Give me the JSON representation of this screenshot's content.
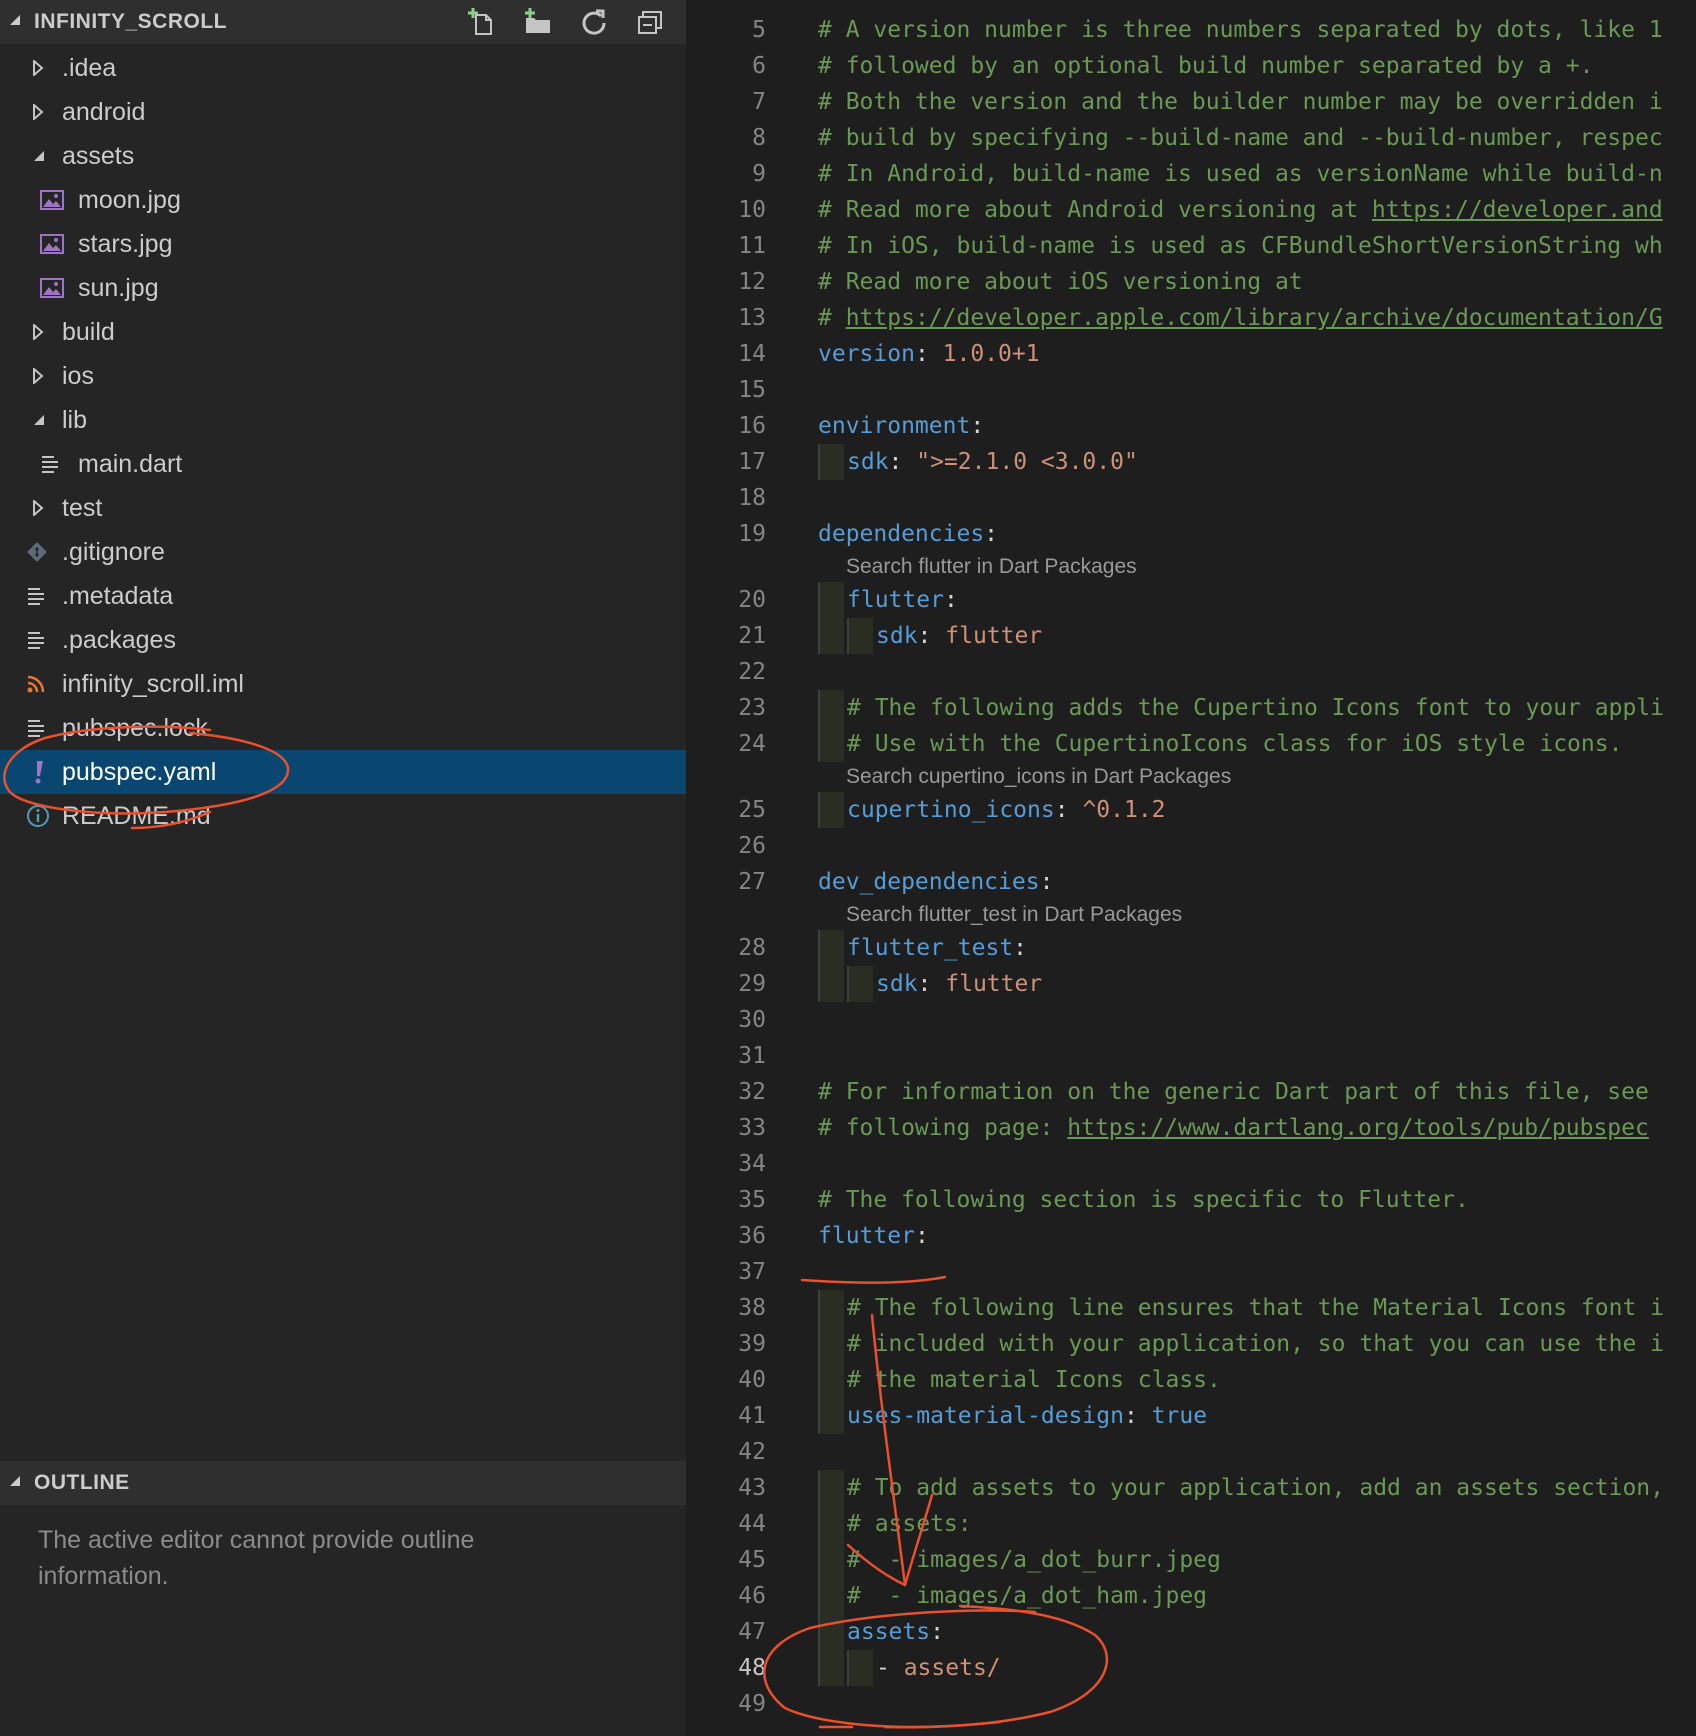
{
  "explorer": {
    "title": "INFINITY_SCROLL",
    "actions": [
      "new-file",
      "new-folder",
      "refresh",
      "collapse-all"
    ],
    "items": [
      {
        "label": ".idea",
        "type": "folder",
        "expanded": false,
        "depth": 0
      },
      {
        "label": "android",
        "type": "folder",
        "expanded": false,
        "depth": 0
      },
      {
        "label": "assets",
        "type": "folder",
        "expanded": true,
        "depth": 0
      },
      {
        "label": "moon.jpg",
        "type": "image",
        "depth": 1
      },
      {
        "label": "stars.jpg",
        "type": "image",
        "depth": 1
      },
      {
        "label": "sun.jpg",
        "type": "image",
        "depth": 1
      },
      {
        "label": "build",
        "type": "folder",
        "expanded": false,
        "depth": 0
      },
      {
        "label": "ios",
        "type": "folder",
        "expanded": false,
        "depth": 0
      },
      {
        "label": "lib",
        "type": "folder",
        "expanded": true,
        "depth": 0
      },
      {
        "label": "main.dart",
        "type": "lines",
        "depth": 1
      },
      {
        "label": "test",
        "type": "folder",
        "expanded": false,
        "depth": 0
      },
      {
        "label": ".gitignore",
        "type": "git",
        "depth": 0
      },
      {
        "label": ".metadata",
        "type": "lines",
        "depth": 0
      },
      {
        "label": ".packages",
        "type": "lines",
        "depth": 0
      },
      {
        "label": "infinity_scroll.iml",
        "type": "rss",
        "depth": 0
      },
      {
        "label": "pubspec.lock",
        "type": "lines",
        "depth": 0
      },
      {
        "label": "pubspec.yaml",
        "type": "yaml",
        "depth": 0,
        "selected": true
      },
      {
        "label": "README.md",
        "type": "info",
        "depth": 0
      }
    ]
  },
  "outline": {
    "title": "OUTLINE",
    "message": "The active editor cannot provide outline information."
  },
  "editor": {
    "current_line": 48,
    "lines": [
      {
        "n": 5,
        "code": "# A version number is three numbers separated by dots, like 1"
      },
      {
        "n": 6,
        "code": "# followed by an optional build number separated by a +."
      },
      {
        "n": 7,
        "code": "# Both the version and the builder number may be overridden i"
      },
      {
        "n": 8,
        "code": "# build by specifying --build-name and --build-number, respec"
      },
      {
        "n": 9,
        "code": "# In Android, build-name is used as versionName while build-n"
      },
      {
        "n": 10,
        "code": "# Read more about Android versioning at ",
        "link": "https://developer.and"
      },
      {
        "n": 11,
        "code": "# In iOS, build-name is used as CFBundleShortVersionString wh"
      },
      {
        "n": 12,
        "code": "# Read more about iOS versioning at"
      },
      {
        "n": 13,
        "code": "# ",
        "link": "https://developer.apple.com/library/archive/documentation/G"
      },
      {
        "n": 14,
        "key": "version",
        "val": "1.0.0+1",
        "indent": 0
      },
      {
        "n": 15
      },
      {
        "n": 16,
        "key": "environment",
        "indent": 0
      },
      {
        "n": 17,
        "key": "sdk",
        "val": "\">=2.1.0 <3.0.0\"",
        "indent": 1
      },
      {
        "n": 18
      },
      {
        "n": 19,
        "key": "dependencies",
        "indent": 0
      },
      {
        "n": 20,
        "key": "flutter",
        "indent": 1,
        "lens": "Search flutter in Dart Packages"
      },
      {
        "n": 21,
        "key": "sdk",
        "val": "flutter",
        "indent": 2
      },
      {
        "n": 22
      },
      {
        "n": 23,
        "code": "# The following adds the Cupertino Icons font to your appli",
        "indent": 1
      },
      {
        "n": 24,
        "code": "# Use with the CupertinoIcons class for iOS style icons.",
        "indent": 1
      },
      {
        "n": 25,
        "key": "cupertino_icons",
        "val": "^0.1.2",
        "indent": 1,
        "lens": "Search cupertino_icons in Dart Packages"
      },
      {
        "n": 26
      },
      {
        "n": 27,
        "key": "dev_dependencies",
        "indent": 0
      },
      {
        "n": 28,
        "key": "flutter_test",
        "indent": 1,
        "lens": "Search flutter_test in Dart Packages"
      },
      {
        "n": 29,
        "key": "sdk",
        "val": "flutter",
        "indent": 2
      },
      {
        "n": 30
      },
      {
        "n": 31
      },
      {
        "n": 32,
        "code": "# For information on the generic Dart part of this file, see"
      },
      {
        "n": 33,
        "code": "# following page: ",
        "link": "https://www.dartlang.org/tools/pub/pubspec"
      },
      {
        "n": 34
      },
      {
        "n": 35,
        "code": "# The following section is specific to Flutter."
      },
      {
        "n": 36,
        "key": "flutter",
        "indent": 0
      },
      {
        "n": 37
      },
      {
        "n": 38,
        "code": "# The following line ensures that the Material Icons font i",
        "indent": 1
      },
      {
        "n": 39,
        "code": "# included with your application, so that you can use the i",
        "indent": 1
      },
      {
        "n": 40,
        "code": "# the material Icons class.",
        "indent": 1
      },
      {
        "n": 41,
        "key": "uses-material-design",
        "val": "true",
        "valType": "bool",
        "indent": 1
      },
      {
        "n": 42
      },
      {
        "n": 43,
        "code": "# To add assets to your application, add an assets section,",
        "indent": 1
      },
      {
        "n": 44,
        "code": "# assets:",
        "indent": 1
      },
      {
        "n": 45,
        "code": "#  - images/a_dot_burr.jpeg",
        "indent": 1
      },
      {
        "n": 46,
        "code": "#  - images/a_dot_ham.jpeg",
        "indent": 1
      },
      {
        "n": 47,
        "key": "assets",
        "indent": 1
      },
      {
        "n": 48,
        "item": "assets/",
        "indent": 2
      },
      {
        "n": 49
      }
    ]
  }
}
